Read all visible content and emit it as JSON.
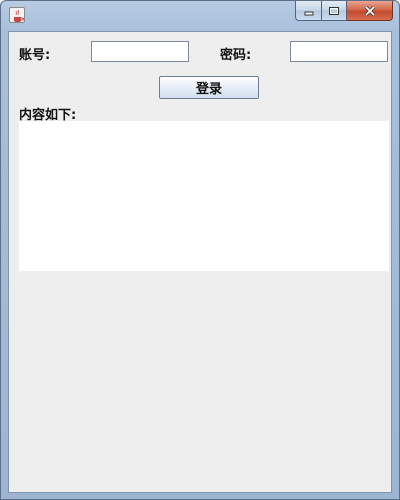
{
  "window": {
    "icon": "java-cup-icon",
    "caption_buttons": [
      "minimize-icon",
      "maximize-icon",
      "close-icon"
    ]
  },
  "form": {
    "account_label": "账号:",
    "account_value": "",
    "password_label": "密码:",
    "password_value": "",
    "login_button": "登录",
    "content_label": "内容如下:",
    "content_value": ""
  },
  "colors": {
    "client_bg": "#eeeeee",
    "titlebar": "#a9c0db",
    "close_button": "#c24a2e"
  }
}
